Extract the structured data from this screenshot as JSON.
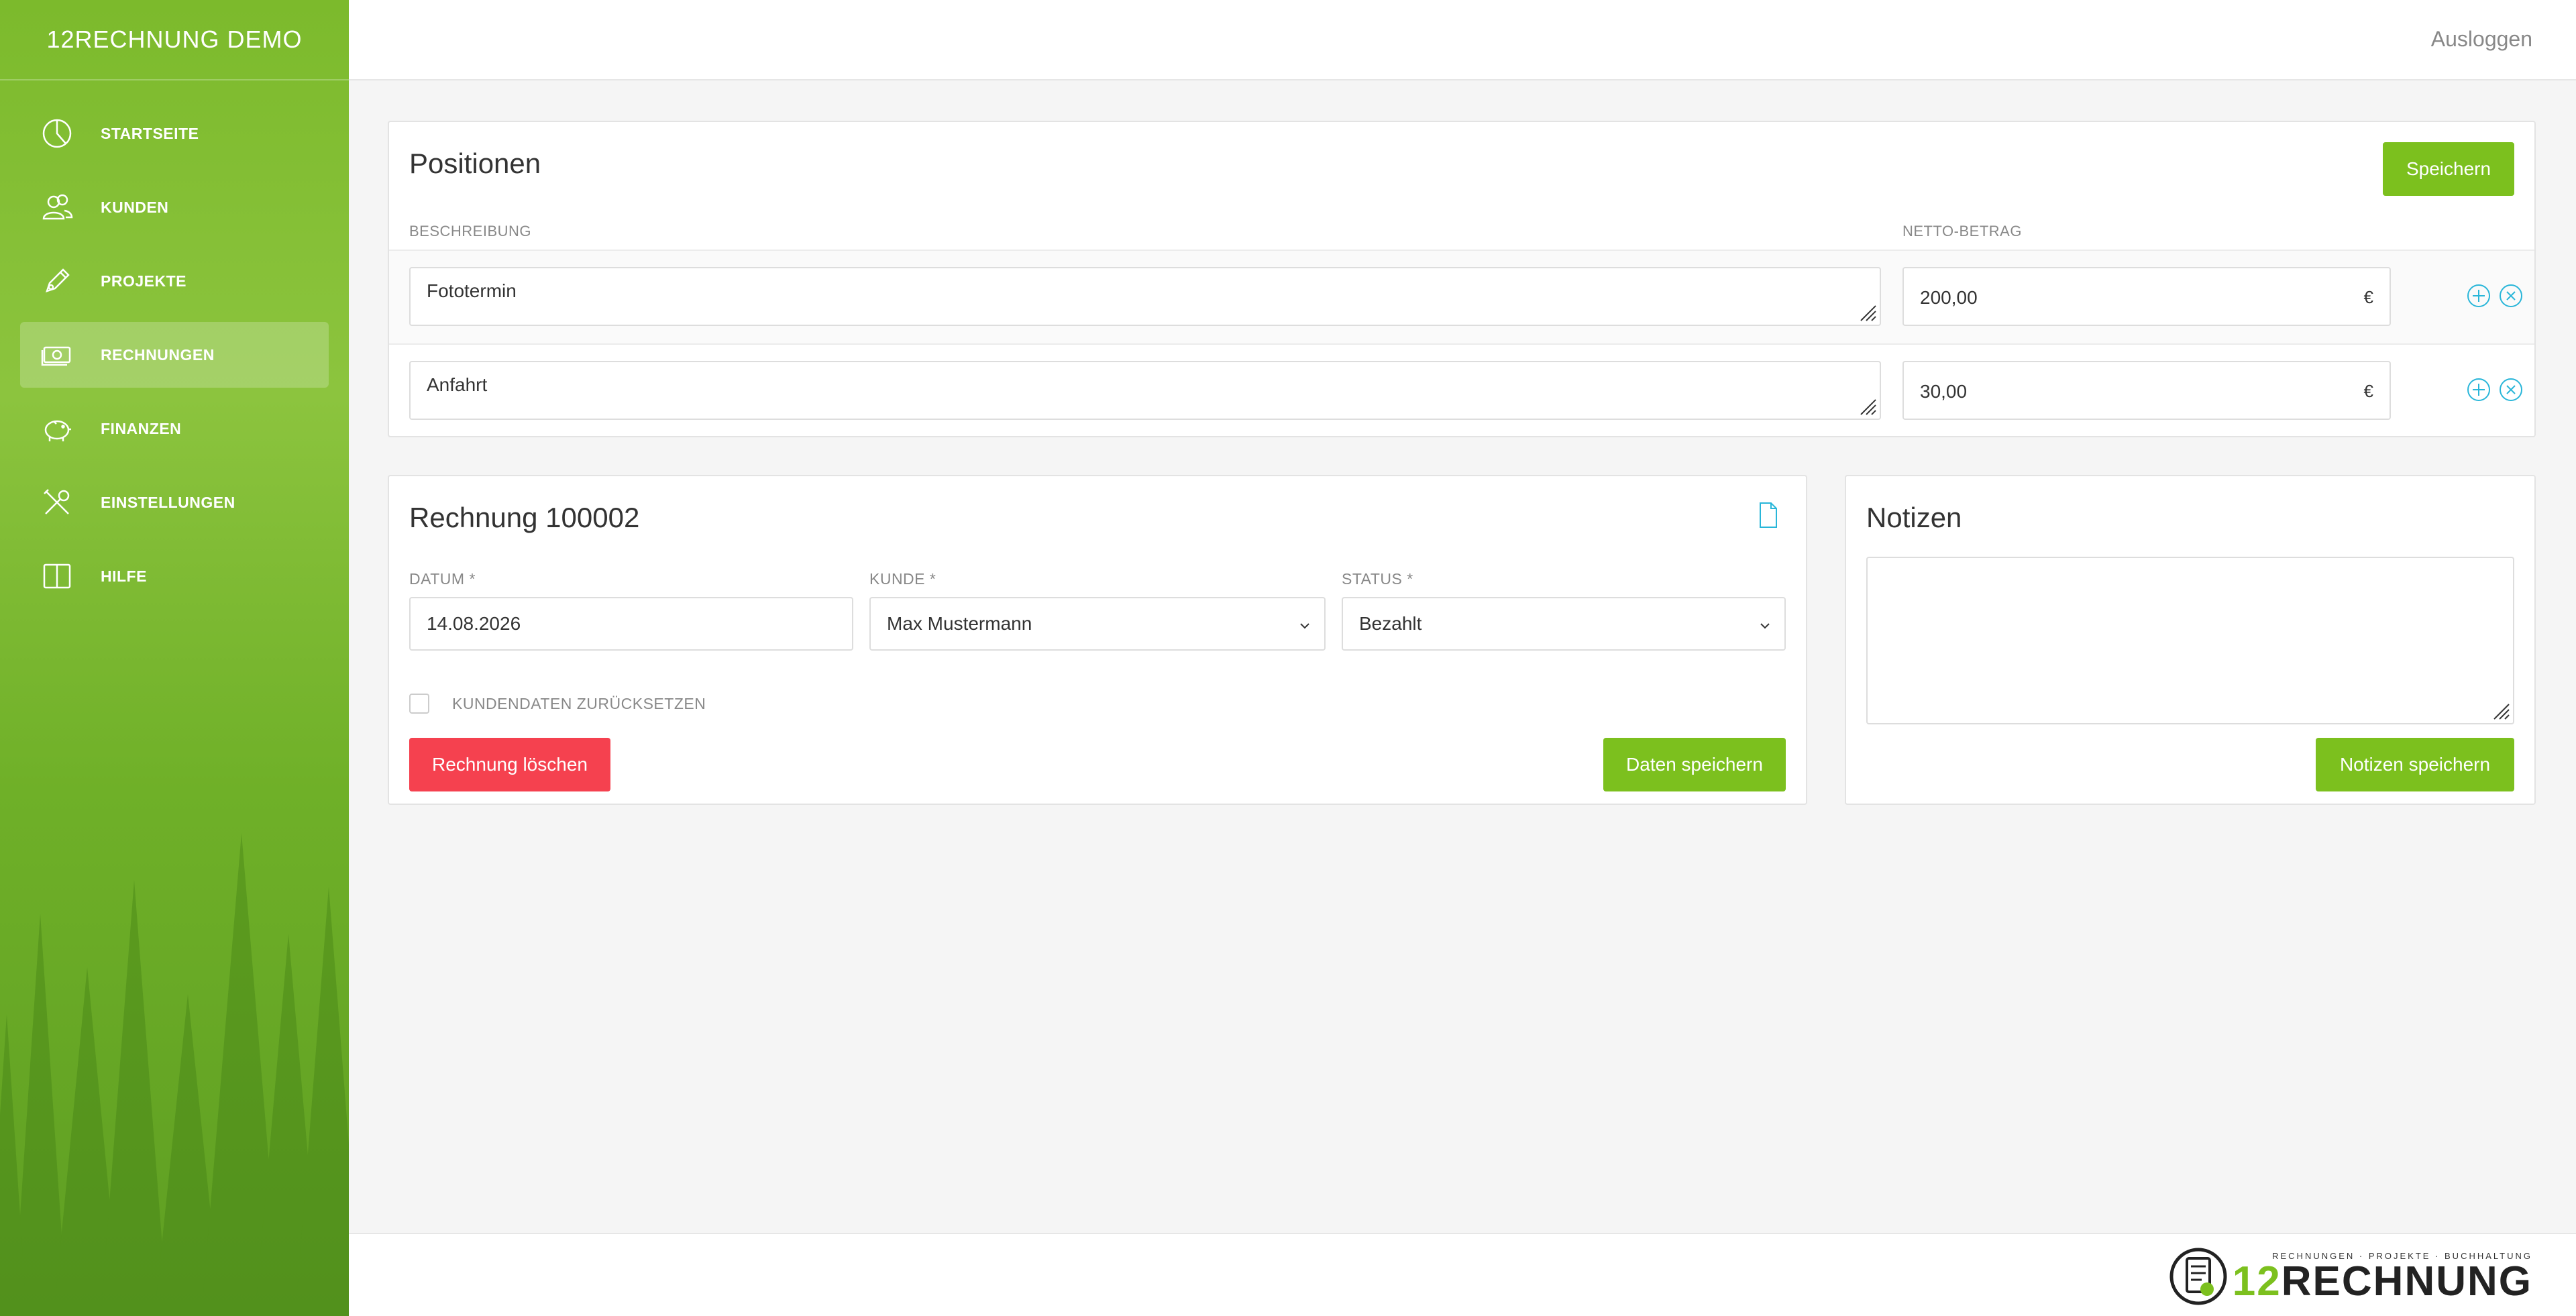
{
  "app": {
    "title": "12RECHNUNG DEMO"
  },
  "sidebar": {
    "items": [
      {
        "label": "STARTSEITE",
        "icon": "chart-pie-icon"
      },
      {
        "label": "KUNDEN",
        "icon": "users-icon"
      },
      {
        "label": "PROJEKTE",
        "icon": "pencil-icon"
      },
      {
        "label": "RECHNUNGEN",
        "icon": "money-icon",
        "active": true
      },
      {
        "label": "FINANZEN",
        "icon": "piggy-bank-icon"
      },
      {
        "label": "EINSTELLUNGEN",
        "icon": "tools-icon"
      },
      {
        "label": "HILFE",
        "icon": "book-icon"
      }
    ]
  },
  "topbar": {
    "logout_label": "Ausloggen"
  },
  "positions": {
    "title": "Positionen",
    "save_label": "Speichern",
    "col_description": "BESCHREIBUNG",
    "col_amount": "NETTO-BETRAG",
    "currency": "€",
    "rows": [
      {
        "description": "Fototermin",
        "amount": "200,00"
      },
      {
        "description": "Anfahrt",
        "amount": "30,00"
      }
    ]
  },
  "invoice": {
    "title": "Rechnung 100002",
    "date_label": "DATUM *",
    "date_value": "14.08.2026",
    "customer_label": "KUNDE *",
    "customer_value": "Max Mustermann",
    "status_label": "STATUS *",
    "status_value": "Bezahlt",
    "reset_label": "KUNDENDATEN ZURÜCKSETZEN",
    "delete_label": "Rechnung löschen",
    "save_label": "Daten speichern"
  },
  "notes": {
    "title": "Notizen",
    "value": "",
    "save_label": "Notizen speichern"
  },
  "footer": {
    "tagline": "RECHNUNGEN · PROJEKTE · BUCHHALTUNG",
    "logo_prefix": "12",
    "logo_suffix": "RECHNUNG"
  },
  "colors": {
    "brand_green": "#7cc01e",
    "danger_red": "#f5414f",
    "icon_cyan": "#29b6d9"
  }
}
